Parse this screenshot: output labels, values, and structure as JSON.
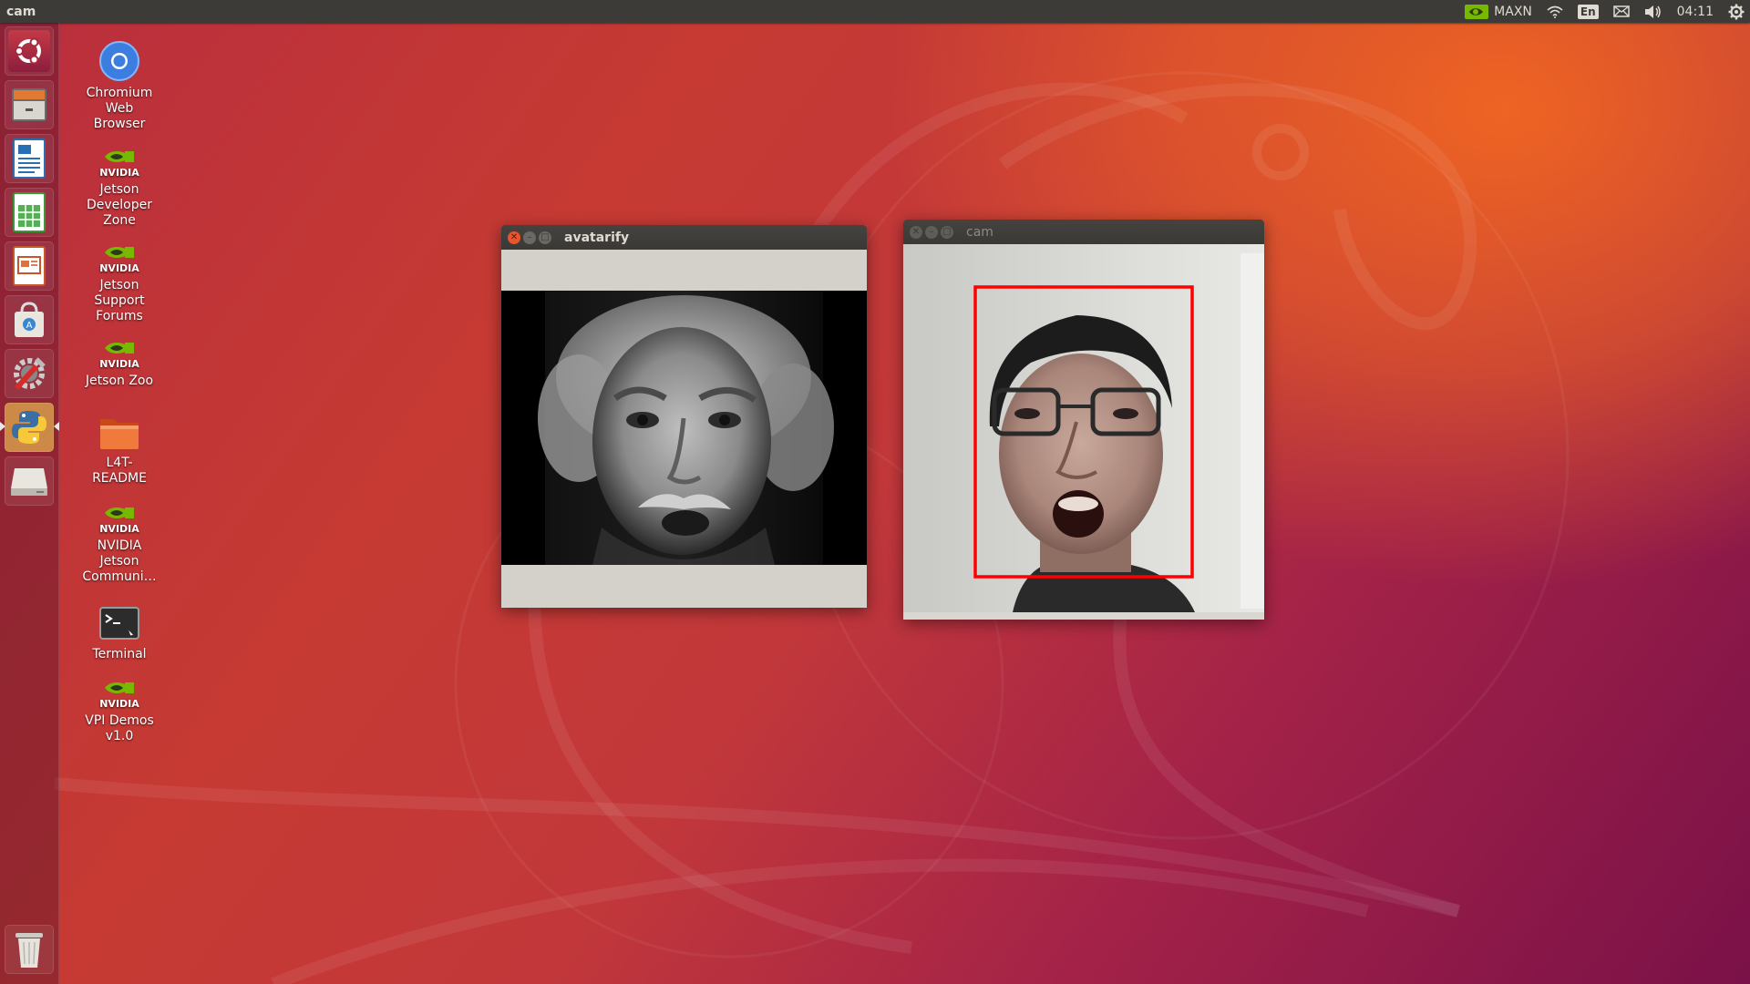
{
  "top_panel": {
    "app_title": "cam",
    "power_mode": "MAXN",
    "keyboard_layout": "En",
    "clock": "04:11",
    "icons": [
      "nvidia-icon",
      "wifi-icon",
      "keyboard-layout-icon",
      "mail-icon",
      "volume-icon",
      "settings-gear-icon"
    ]
  },
  "launcher": {
    "items": [
      {
        "name": "ubuntu-dash",
        "icon": "ubuntu-logo-icon"
      },
      {
        "name": "files",
        "icon": "file-cabinet-icon"
      },
      {
        "name": "libreoffice-writer",
        "icon": "writer-document-icon"
      },
      {
        "name": "libreoffice-calc",
        "icon": "calc-spreadsheet-icon"
      },
      {
        "name": "libreoffice-impress",
        "icon": "impress-presentation-icon"
      },
      {
        "name": "software-center",
        "icon": "shopping-bag-icon"
      },
      {
        "name": "system-settings",
        "icon": "tools-settings-icon"
      },
      {
        "name": "python",
        "icon": "python-icon",
        "active": true
      },
      {
        "name": "drive",
        "icon": "drive-icon"
      },
      {
        "name": "trash",
        "icon": "trash-icon"
      }
    ]
  },
  "desktop_icons": [
    {
      "label": "Chromium\nWeb\nBrowser",
      "icon": "chromium-icon"
    },
    {
      "label": "Jetson\nDeveloper\nZone",
      "icon": "nvidia-logo-icon",
      "brand": "NVIDIA"
    },
    {
      "label": "Jetson\nSupport\nForums",
      "icon": "nvidia-logo-icon",
      "brand": "NVIDIA"
    },
    {
      "label": "Jetson Zoo",
      "icon": "nvidia-logo-icon",
      "brand": "NVIDIA"
    },
    {
      "label": "L4T-\nREADME",
      "icon": "folder-icon"
    },
    {
      "label": "NVIDIA\nJetson\nCommuni…",
      "icon": "nvidia-logo-icon",
      "brand": "NVIDIA"
    },
    {
      "label": "Terminal",
      "icon": "terminal-icon"
    },
    {
      "label": "VPI Demos\nv1.0",
      "icon": "nvidia-logo-icon",
      "brand": "NVIDIA"
    }
  ],
  "windows": {
    "avatarify": {
      "title": "avatarify",
      "active": true,
      "content": "grayscale-avatar-portrait"
    },
    "cam": {
      "title": "cam",
      "active": false,
      "content": "webcam-feed-with-face-detection-box",
      "detection_box_color": "#ff0000"
    }
  },
  "colors": {
    "panel": "#3d3b37",
    "close_button": "#e9542e",
    "wallpaper_orange": "#ee6423",
    "wallpaper_purple": "#7a1148",
    "nvidia_green": "#76b900"
  }
}
